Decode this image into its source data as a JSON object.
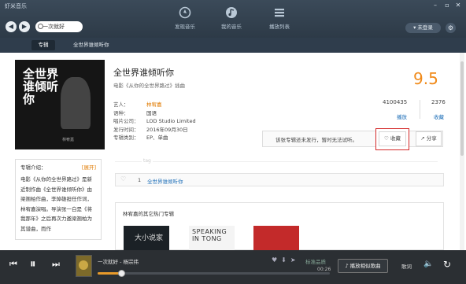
{
  "app": {
    "title": "虾米音乐"
  },
  "search": {
    "value": "一次就好"
  },
  "nav": {
    "items": [
      {
        "label": "发现音乐",
        "icon": "discover-icon"
      },
      {
        "label": "我的音乐",
        "icon": "my-music-icon"
      },
      {
        "label": "播放列表",
        "icon": "playlist-icon"
      }
    ]
  },
  "account": {
    "login_label": "▾ 未登录"
  },
  "tabs": {
    "album_label": "专辑",
    "crumb": "全世界谁倾听你"
  },
  "album": {
    "cover_title": "全世界谁倾听你",
    "cover_artist": "林宥嘉",
    "title": "全世界谁倾听你",
    "description": "电影《从你的全世界路过》插曲",
    "meta": [
      {
        "key": "艺人：",
        "value": "林宥嘉"
      },
      {
        "key": "语种：",
        "value": "国语"
      },
      {
        "key": "唱片公司：",
        "value": "LOD Studio Limited"
      },
      {
        "key": "发行时间：",
        "value": "2016年09月30日"
      },
      {
        "key": "专辑类别：",
        "value": "EP、单曲"
      }
    ],
    "score": "9.5",
    "plays": "4100435",
    "plays_label": "播放",
    "favorites": "2376",
    "favorites_label": "收藏",
    "unreleased_text": "该张专辑还未发行，暂时无法试听。",
    "collect_label": "♡ 收藏",
    "share_label": "↗ 分享",
    "tags_label": "tag"
  },
  "intro": {
    "heading": "专辑介绍：",
    "expand_label": "[展开]",
    "body": "电影《从你的全世界路过》是新近制作曲《全世界谁倾听你》由梁翘柏作曲，李焯雄担任作词，林宥嘉演唱。导演张一白是《将我那年》之后再次力邀梁翘柏为其谱曲，而作"
  },
  "comments": {
    "count": "1",
    "label": "全世界谁倾听你"
  },
  "hot": {
    "title": "林宥嘉的其它热门专辑",
    "albums": [
      {
        "text": "大小说家"
      },
      {
        "text": "SPEAKING IN TONG"
      },
      {
        "text": ""
      }
    ]
  },
  "player": {
    "song": "一次就好 - 杨宗纬",
    "quality": "标准品质",
    "time": "00:26",
    "progress": 0.1,
    "similar_label": "♪ 播放相似歌曲",
    "lyric_label": "歌词"
  }
}
